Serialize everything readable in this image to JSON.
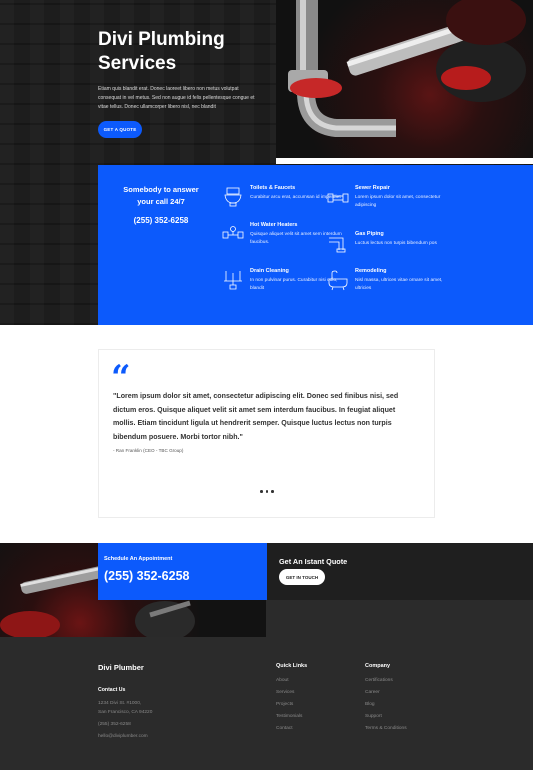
{
  "hero": {
    "title_line1": "Divi Plumbing",
    "title_line2": "Services",
    "description": "Etiam quis blandit erat. Donec laoreet libero non metus volutpat consequat in vel metus. Sed non augue id felis pellentesque congue et vitae tellus. Donec ullamcorper libero nisl, nec blandit",
    "button": "GET A QUOTE"
  },
  "call_panel": {
    "heading_line1": "Somebody to answer",
    "heading_line2": "your call 24/7",
    "phone": "(255) 352-6258"
  },
  "services": [
    {
      "icon": "toilet-icon",
      "title": "Toilets & Faucets",
      "text": "Curabitur arcu erat, accumsan id imperdiet"
    },
    {
      "icon": "water-heater-icon",
      "title": "Hot Water Heaters",
      "text": "Quisque aliquet velit sit amet sem interdum faucibus."
    },
    {
      "icon": "drain-icon",
      "title": "Drain Cleaning",
      "text": "In non pulvinar purus. Curabitur nisi odio, blandit"
    },
    {
      "icon": "pipe-icon",
      "title": "Sewer Repair",
      "text": "Lorem ipsum dolor sit amet, consectetur adipiscing"
    },
    {
      "icon": "gas-pipe-icon",
      "title": "Gas Piping",
      "text": "Luctus lectus non turpis bibendum pos"
    },
    {
      "icon": "bathtub-icon",
      "title": "Remodeling",
      "text": "Nisl massa, ultrices vitae ornare sit amet, ultricies"
    }
  ],
  "testimonial": {
    "quote": "\"Lorem ipsum dolor sit amet, consectetur adipiscing elit. Donec sed finibus nisi, sed dictum eros. Quisque aliquet velit sit amet sem interdum faucibus. In feugiat aliquet mollis. Etiam tincidunt ligula ut hendrerit semper. Quisque luctus lectus non turpis bibendum posuere. Morbi tortor nibh.\"",
    "author": "- Ran Franklin (CEO - TBC Group)"
  },
  "cta": {
    "schedule_label": "Schedule An Appointment",
    "phone": "(255) 352-6258",
    "quote_title": "Get An Istant Quote",
    "quote_button": "GET IN TOUCH"
  },
  "footer": {
    "brand": "Divi Plumber",
    "contact_heading": "Contact Us",
    "address_line1": "1234 Divi St. #1000,",
    "address_line2": "San Francisco, CA 94220",
    "phone": "(255) 352-6258",
    "email": "hello@diviplumber.com",
    "quick_links_heading": "Quick Links",
    "quick_links": [
      "About",
      "Services",
      "Projects",
      "Testimonials",
      "Contact"
    ],
    "company_heading": "Company",
    "company_links": [
      "Certifications",
      "Career",
      "Blog",
      "Support",
      "Terms & Conditions"
    ]
  },
  "colors": {
    "accent": "#0c5afc",
    "dark": "#1d1d1d",
    "footer": "#2b2b2b"
  }
}
